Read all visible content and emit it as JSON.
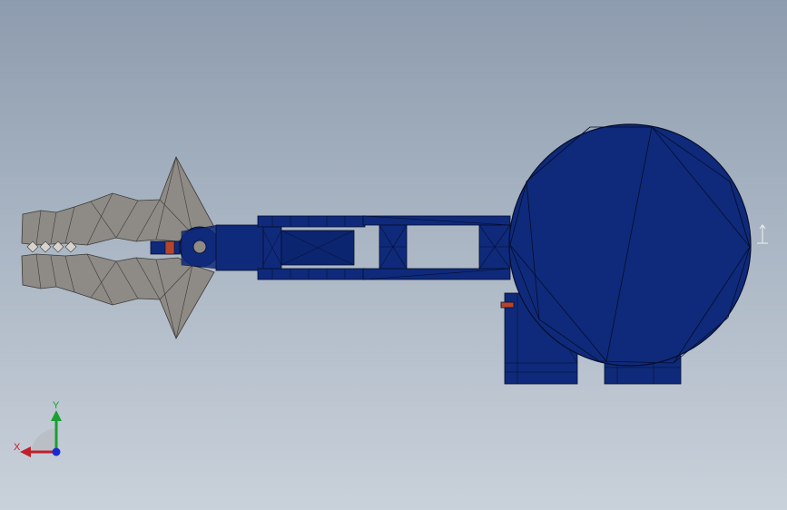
{
  "viewport": {
    "background_top": "#8d9cae",
    "background_bottom": "#c9d1da"
  },
  "model": {
    "gripper_color": "#8e8a86",
    "body_color": "#0f2a7a",
    "edge_color": "#050d2e",
    "accent_color": "#b5452b"
  },
  "triad": {
    "x_label": "X",
    "y_label": "Y",
    "x_color": "#c0202a",
    "y_color": "#18a030",
    "z_color": "#1a2ad0"
  },
  "icons": [
    "axis-triad-icon",
    "view-orientation-marker-icon"
  ]
}
